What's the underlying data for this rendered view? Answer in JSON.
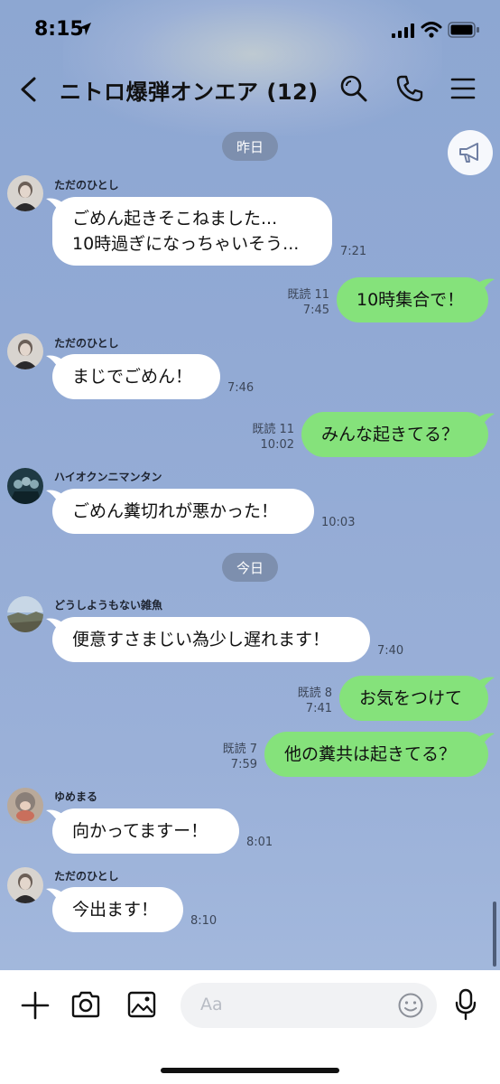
{
  "status_bar": {
    "time": "8:15"
  },
  "header": {
    "title": "ニトロ爆弾オンエア (12)"
  },
  "date_labels": {
    "yesterday": "昨日",
    "today": "今日"
  },
  "messages": [
    {
      "sender": "ただのひとし",
      "lines": [
        "ごめん起きそこねました...",
        "10時過ぎになっちゃいそう..."
      ],
      "time": "7:21"
    },
    {
      "read": "既読 11",
      "time": "7:45",
      "text": "10時集合で！"
    },
    {
      "sender": "ただのひとし",
      "text": "まじでごめん！",
      "time": "7:46"
    },
    {
      "read": "既読 11",
      "time": "10:02",
      "text": "みんな起きてる？"
    },
    {
      "sender": "ハイオクンニマンタン",
      "text": "ごめん糞切れが悪かった！",
      "time": "10:03"
    },
    {
      "sender": "どうしようもない雑魚",
      "text": "便意すさまじい為少し遅れます！",
      "time": "7:40"
    },
    {
      "read": "既読 8",
      "time": "7:41",
      "text": "お気をつけて"
    },
    {
      "read": "既読 7",
      "time": "7:59",
      "text": "他の糞共は起きてる？"
    },
    {
      "sender": "ゆめまる",
      "text": "向かってますー！",
      "time": "8:01"
    },
    {
      "sender": "ただのひとし",
      "text": "今出ます！",
      "time": "8:10"
    }
  ],
  "input": {
    "placeholder": "Aa"
  },
  "colors": {
    "background": "#91a9d4",
    "outgoing_bubble": "#85e27b",
    "incoming_bubble": "#ffffff",
    "date_pill": "#7d8fae"
  },
  "icons": [
    "location-arrow-icon",
    "signal-icon",
    "wifi-icon",
    "battery-icon",
    "back-icon",
    "search-icon",
    "phone-icon",
    "menu-icon",
    "megaphone-icon",
    "plus-icon",
    "camera-icon",
    "image-icon",
    "emoji-icon",
    "mic-icon"
  ]
}
